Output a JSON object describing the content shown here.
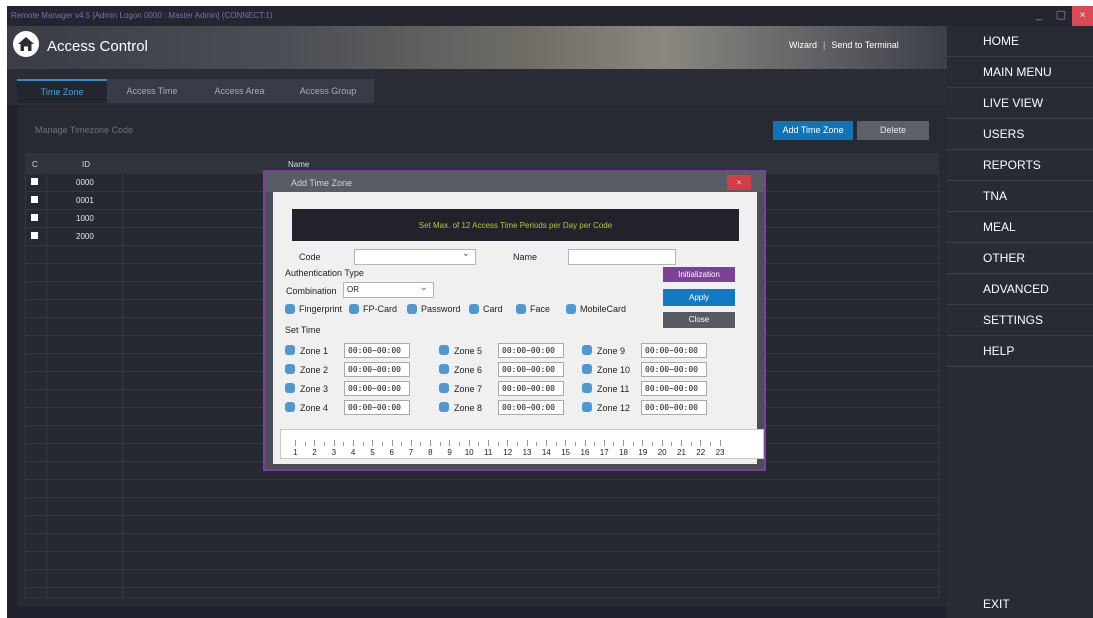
{
  "window": {
    "title": "Remote Manager v4.5 [Admin Logon 0000 : Master Admin] (CONNECT:1)",
    "controls": [
      "_",
      "▢",
      "×"
    ]
  },
  "header": {
    "title": "Access Control",
    "links": [
      "Wizard",
      "Send to Terminal"
    ],
    "separator": "|"
  },
  "tabs": [
    {
      "label": "Time Zone",
      "active": true
    },
    {
      "label": "Access Time",
      "active": false
    },
    {
      "label": "Access Area",
      "active": false
    },
    {
      "label": "Access Group",
      "active": false
    }
  ],
  "toolbar": {
    "section_label": "Manage Timezone Code",
    "add_label": "Add Time Zone",
    "delete_label": "Delete"
  },
  "grid": {
    "columns": [
      "C",
      "ID",
      "Name"
    ],
    "rows": [
      {
        "id": "0000",
        "name": ""
      },
      {
        "id": "0001",
        "name": ""
      },
      {
        "id": "1000",
        "name": ""
      },
      {
        "id": "2000",
        "name": ""
      }
    ]
  },
  "sidebar": {
    "items": [
      "HOME",
      "MAIN MENU",
      "LIVE VIEW",
      "USERS",
      "REPORTS",
      "TNA",
      "MEAL",
      "OTHER",
      "ADVANCED",
      "SETTINGS",
      "HELP"
    ],
    "exit": "EXIT"
  },
  "dialog": {
    "title": "Add Time Zone",
    "close": "×",
    "banner": "Set Max. of 12 Access Time Periods per Day per Code",
    "code_label": "Code",
    "code_value": "",
    "name_label": "Name",
    "name_value": "",
    "auth_label": "Authentication Type",
    "combination_label": "Combination",
    "combination_value": "OR",
    "auth_options": [
      "Fingerprint",
      "FP-Card",
      "Password",
      "Card",
      "Face",
      "MobileCard"
    ],
    "set_time_label": "Set Time",
    "zones": [
      {
        "label": "Zone 1",
        "value": "00:00~00:00"
      },
      {
        "label": "Zone 2",
        "value": "00:00~00:00"
      },
      {
        "label": "Zone 3",
        "value": "00:00~00:00"
      },
      {
        "label": "Zone 4",
        "value": "00:00~00:00"
      },
      {
        "label": "Zone 5",
        "value": "00:00~00:00"
      },
      {
        "label": "Zone 6",
        "value": "00:00~00:00"
      },
      {
        "label": "Zone 7",
        "value": "00:00~00:00"
      },
      {
        "label": "Zone 8",
        "value": "00:00~00:00"
      },
      {
        "label": "Zone 9",
        "value": "00:00~00:00"
      },
      {
        "label": "Zone 10",
        "value": "00:00~00:00"
      },
      {
        "label": "Zone 11",
        "value": "00:00~00:00"
      },
      {
        "label": "Zone 12",
        "value": "00:00~00:00"
      }
    ],
    "buttons": {
      "init": "Initialization",
      "apply": "Apply",
      "close": "Close"
    },
    "timeline_labels": [
      "1",
      "2",
      "3",
      "4",
      "5",
      "6",
      "7",
      "8",
      "9",
      "10",
      "11",
      "12",
      "13",
      "14",
      "15",
      "16",
      "17",
      "18",
      "19",
      "20",
      "21",
      "22",
      "23"
    ]
  },
  "colors": {
    "accent": "#1274b6",
    "dialog_border": "#7b3fa0",
    "init_button": "#7c4197",
    "banner_text": "#b6c43a",
    "close_red": "#d94a56"
  }
}
